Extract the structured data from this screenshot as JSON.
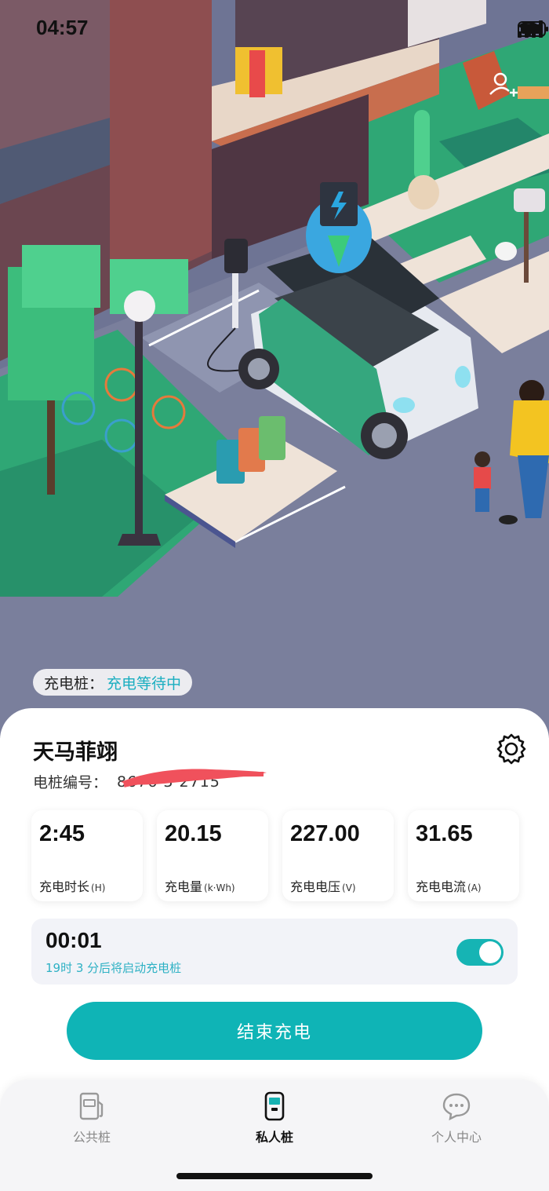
{
  "status_bar": {
    "time": "04:57"
  },
  "charger_status": {
    "label": "充电桩：",
    "value": "充电等待中"
  },
  "station": {
    "name": "天马菲翊",
    "pile_no_label": "电桩编号：",
    "pile_no_visible": "8676      3    2715"
  },
  "stats": [
    {
      "value": "2:45",
      "label": "充电时长",
      "unit": "(H)"
    },
    {
      "value": "20.15",
      "label": "充电量",
      "unit": "(k·Wh)"
    },
    {
      "value": "227.00",
      "label": "充电电压",
      "unit": "(V)"
    },
    {
      "value": "31.65",
      "label": "充电电流",
      "unit": "(A)"
    }
  ],
  "timer": {
    "value": "00:01",
    "note": "19时 3 分后将启动充电桩",
    "enabled": true
  },
  "stop_button": "结束充电",
  "tabs": [
    {
      "label": "公共桩",
      "icon": "public-charger-icon",
      "active": false
    },
    {
      "label": "私人桩",
      "icon": "private-charger-icon",
      "active": true
    },
    {
      "label": "个人中心",
      "icon": "chat-bubble-icon",
      "active": false
    }
  ],
  "colors": {
    "accent": "#0fb4b6",
    "status_text": "#1aaec0"
  }
}
